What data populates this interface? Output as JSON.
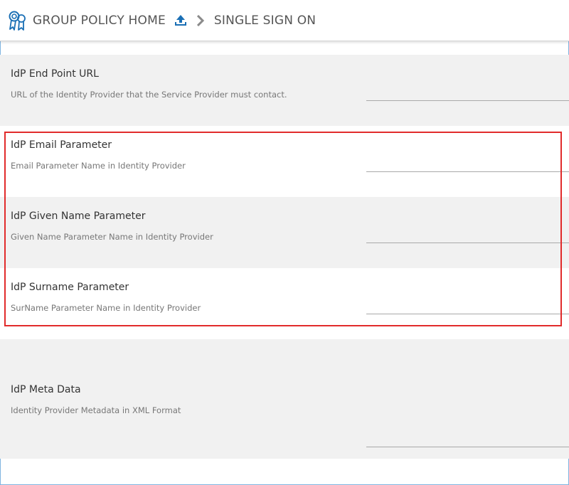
{
  "header": {
    "home_label": "GROUP POLICY HOME",
    "current_label": "SINGLE SIGN ON",
    "accent_color": "#1a6fb5"
  },
  "settings": [
    {
      "title": "IdP End Point URL",
      "description": "URL of the Identity Provider that the Service Provider must contact.",
      "value": ""
    },
    {
      "title": "IdP Email Parameter",
      "description": "Email Parameter Name in Identity Provider",
      "value": ""
    },
    {
      "title": "IdP Given Name Parameter",
      "description": "Given Name Parameter Name in Identity Provider",
      "value": ""
    },
    {
      "title": "IdP Surname Parameter",
      "description": "SurName Parameter Name in Identity Provider",
      "value": ""
    },
    {
      "title": "IdP Meta Data",
      "description": "Identity Provider Metadata in XML Format",
      "value": ""
    }
  ],
  "highlight_color": "#e12b2b"
}
